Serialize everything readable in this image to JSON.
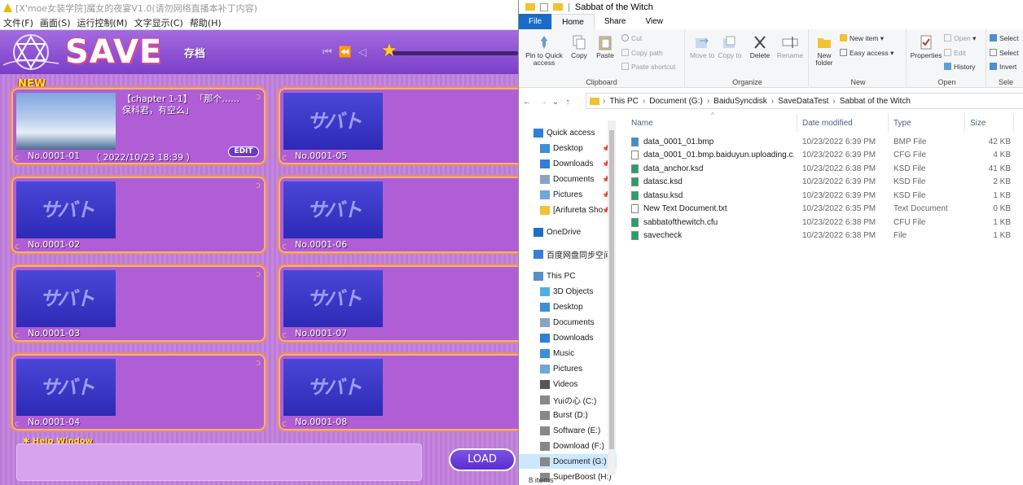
{
  "game": {
    "window_title": "[X'moe女装学院]魔女的夜宴V1.0(请勿网络直播本补丁内容)",
    "menu": [
      "文件(F)",
      "画面(S)",
      "运行控制(M)",
      "文字显示(C)",
      "帮助(H)"
    ],
    "header_title": "SAVE",
    "header_subtitle": "存档",
    "nav_icons": [
      "first-page-icon",
      "prev-page-icon",
      "prev-icon"
    ],
    "new_badge": "NEW",
    "watermark": "サバト",
    "slots": [
      {
        "no": "No.0001-01",
        "date": "（ 2022/10/23 18:39 ）",
        "text": "【chapter  1-1】 「那个……保科君，有空么」",
        "edit": "EDIT",
        "has_thumb": true
      },
      {
        "no": "No.0001-05",
        "date": "",
        "text": "",
        "edit": "",
        "has_thumb": false
      },
      {
        "no": "No.0001-02",
        "date": "",
        "text": "",
        "edit": "",
        "has_thumb": false
      },
      {
        "no": "No.0001-06",
        "date": "",
        "text": "",
        "edit": "",
        "has_thumb": false
      },
      {
        "no": "No.0001-03",
        "date": "",
        "text": "",
        "edit": "",
        "has_thumb": false
      },
      {
        "no": "No.0001-07",
        "date": "",
        "text": "",
        "edit": "",
        "has_thumb": false
      },
      {
        "no": "No.0001-04",
        "date": "",
        "text": "",
        "edit": "",
        "has_thumb": false
      },
      {
        "no": "No.0001-08",
        "date": "",
        "text": "",
        "edit": "",
        "has_thumb": false
      }
    ],
    "help_label": "✱ Help Window",
    "load_label": "LOAD"
  },
  "explorer": {
    "window_title": "Sabbat of the Witch",
    "tabs": [
      "File",
      "Home",
      "Share",
      "View"
    ],
    "ribbon": {
      "clipboard": {
        "label": "Clipboard",
        "pin": "Pin to Quick access",
        "copy": "Copy",
        "paste": "Paste",
        "cut": "Cut",
        "copy_path": "Copy path",
        "paste_shortcut": "Paste shortcut"
      },
      "organize": {
        "label": "Organize",
        "move_to": "Move to",
        "copy_to": "Copy to",
        "delete": "Delete",
        "rename": "Rename"
      },
      "new": {
        "label": "New",
        "new_folder": "New folder",
        "new_item": "New item",
        "easy_access": "Easy access"
      },
      "open": {
        "label": "Open",
        "properties": "Properties",
        "open": "Open",
        "edit": "Edit",
        "history": "History"
      },
      "select": {
        "label": "Sele",
        "select_all": "Select",
        "select_none": "Select",
        "invert": "Invert"
      }
    },
    "breadcrumb": [
      "This PC",
      "Document (G:)",
      "BaiduSyncdisk",
      "SaveDataTest",
      "Sabbat of the Witch"
    ],
    "sidebar": [
      {
        "label": "Quick access",
        "icon": "star-icon",
        "pinned": false,
        "indent": 0
      },
      {
        "label": "Desktop",
        "icon": "desktop-icon",
        "pinned": true,
        "indent": 1
      },
      {
        "label": "Downloads",
        "icon": "download-icon",
        "pinned": true,
        "indent": 1
      },
      {
        "label": "Documents",
        "icon": "documents-icon",
        "pinned": true,
        "indent": 1
      },
      {
        "label": "Pictures",
        "icon": "pictures-icon",
        "pinned": true,
        "indent": 1
      },
      {
        "label": "[Arifureta Sho",
        "icon": "folder-icon",
        "pinned": true,
        "indent": 1
      },
      {
        "label": "OneDrive",
        "icon": "cloud-icon",
        "pinned": false,
        "indent": 0
      },
      {
        "label": "百度网盘同步空间",
        "icon": "baidu-icon",
        "pinned": false,
        "indent": 0
      },
      {
        "label": "This PC",
        "icon": "pc-icon",
        "pinned": false,
        "indent": 0
      },
      {
        "label": "3D Objects",
        "icon": "cube-icon",
        "pinned": false,
        "indent": 1
      },
      {
        "label": "Desktop",
        "icon": "desktop-icon",
        "pinned": false,
        "indent": 1
      },
      {
        "label": "Documents",
        "icon": "documents-icon",
        "pinned": false,
        "indent": 1
      },
      {
        "label": "Downloads",
        "icon": "download-icon",
        "pinned": false,
        "indent": 1
      },
      {
        "label": "Music",
        "icon": "music-icon",
        "pinned": false,
        "indent": 1
      },
      {
        "label": "Pictures",
        "icon": "pictures-icon",
        "pinned": false,
        "indent": 1
      },
      {
        "label": "Videos",
        "icon": "videos-icon",
        "pinned": false,
        "indent": 1
      },
      {
        "label": "Yuiの心 (C:)",
        "icon": "drive-icon",
        "pinned": false,
        "indent": 1
      },
      {
        "label": "Burst (D:)",
        "icon": "drive-icon",
        "pinned": false,
        "indent": 1
      },
      {
        "label": "Software (E:)",
        "icon": "drive-icon",
        "pinned": false,
        "indent": 1
      },
      {
        "label": "Download (F:)",
        "icon": "drive-icon",
        "pinned": false,
        "indent": 1
      },
      {
        "label": "Document (G:)",
        "icon": "drive-icon",
        "pinned": false,
        "indent": 1,
        "selected": true
      },
      {
        "label": "SuperBoost (H:)",
        "icon": "drive-icon",
        "pinned": false,
        "indent": 1
      }
    ],
    "columns": [
      "Name",
      "Date modified",
      "Type",
      "Size"
    ],
    "files": [
      {
        "name": "data_0001_01.bmp",
        "date": "10/23/2022 6:39 PM",
        "type": "BMP File",
        "size": "42 KB"
      },
      {
        "name": "data_0001_01.bmp.baiduyun.uploading.c...",
        "date": "10/23/2022 6:39 PM",
        "type": "CFG File",
        "size": "4 KB"
      },
      {
        "name": "data_anchor.ksd",
        "date": "10/23/2022 6:38 PM",
        "type": "KSD File",
        "size": "41 KB"
      },
      {
        "name": "datasc.ksd",
        "date": "10/23/2022 6:39 PM",
        "type": "KSD File",
        "size": "2 KB"
      },
      {
        "name": "datasu.ksd",
        "date": "10/23/2022 6:39 PM",
        "type": "KSD File",
        "size": "1 KB"
      },
      {
        "name": "New Text Document.txt",
        "date": "10/23/2022 6:35 PM",
        "type": "Text Document",
        "size": "0 KB"
      },
      {
        "name": "sabbatofthewitch.cfu",
        "date": "10/23/2022 6:38 PM",
        "type": "CFU File",
        "size": "1 KB"
      },
      {
        "name": "savecheck",
        "date": "10/23/2022 6:38 PM",
        "type": "File",
        "size": "1 KB"
      }
    ],
    "status": "8 items"
  }
}
